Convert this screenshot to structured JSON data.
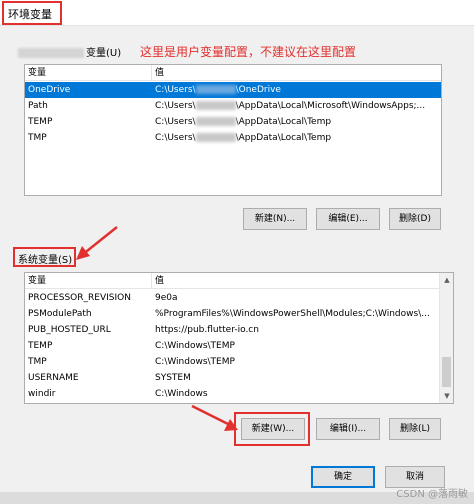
{
  "window": {
    "title": "环境变量"
  },
  "user_section": {
    "label_suffix": "变量(U)",
    "annotation": "这里是用户变量配置，不建议在这里配置",
    "columns": [
      "变量",
      "值"
    ],
    "rows": [
      {
        "name": "OneDrive",
        "value_prefix": "C:\\Users\\",
        "value_suffix": "\\OneDrive",
        "selected": true
      },
      {
        "name": "Path",
        "value_prefix": "C:\\Users\\",
        "value_suffix": "\\AppData\\Local\\Microsoft\\WindowsApps;...",
        "selected": false
      },
      {
        "name": "TEMP",
        "value_prefix": "C:\\Users\\",
        "value_suffix": "\\AppData\\Local\\Temp",
        "selected": false
      },
      {
        "name": "TMP",
        "value_prefix": "C:\\Users\\",
        "value_suffix": "\\AppData\\Local\\Temp",
        "selected": false
      }
    ],
    "buttons": {
      "new": "新建(N)...",
      "edit": "编辑(E)...",
      "delete": "删除(D)"
    }
  },
  "system_section": {
    "label": "系统变量(S)",
    "columns": [
      "变量",
      "值"
    ],
    "rows": [
      {
        "name": "PROCESSOR_REVISION",
        "value": "9e0a"
      },
      {
        "name": "PSModulePath",
        "value": "%ProgramFiles%\\WindowsPowerShell\\Modules;C:\\Windows\\..."
      },
      {
        "name": "PUB_HOSTED_URL",
        "value": "https://pub.flutter-io.cn"
      },
      {
        "name": "TEMP",
        "value": "C:\\Windows\\TEMP"
      },
      {
        "name": "TMP",
        "value": "C:\\Windows\\TEMP"
      },
      {
        "name": "USERNAME",
        "value": "SYSTEM"
      },
      {
        "name": "windir",
        "value": "C:\\Windows"
      }
    ],
    "buttons": {
      "new": "新建(W)...",
      "edit": "编辑(I)...",
      "delete": "删除(L)"
    }
  },
  "dialog_buttons": {
    "ok": "确定",
    "cancel": "取消"
  },
  "watermark": "CSDN @落雨敏",
  "colors": {
    "annotation": "#e2302e",
    "selection": "#0078d7"
  }
}
